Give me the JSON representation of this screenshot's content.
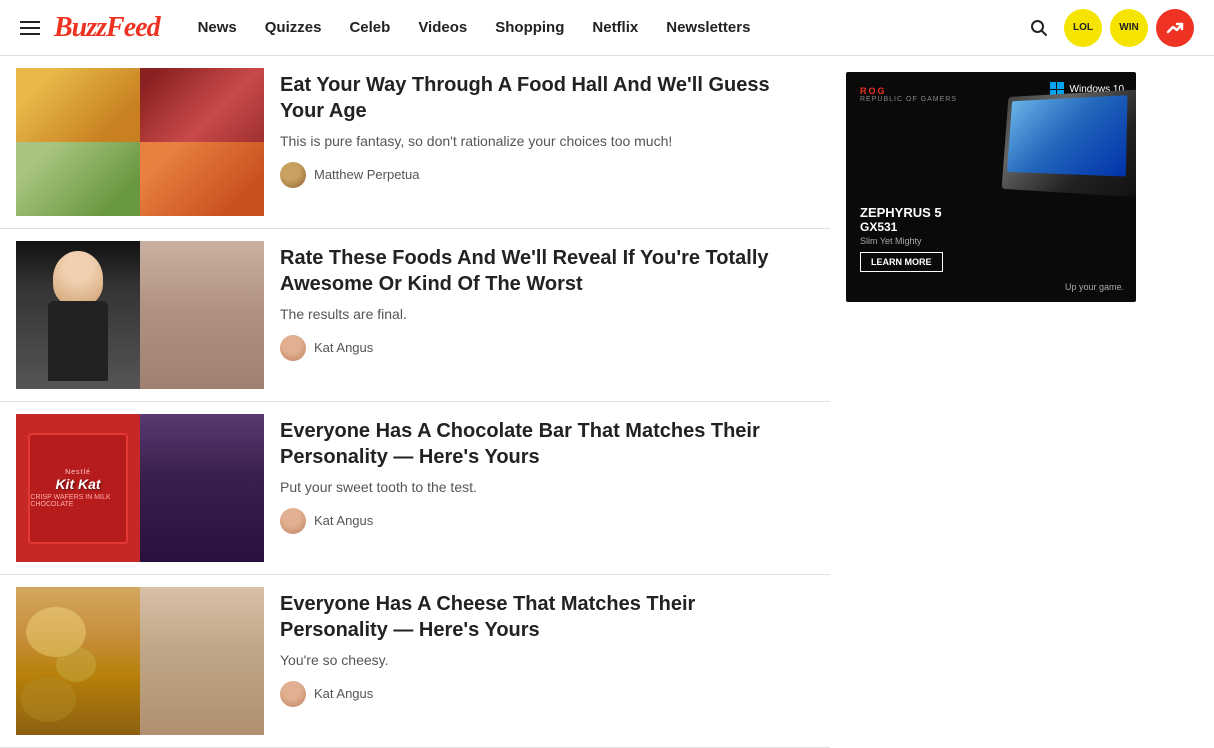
{
  "header": {
    "logo": "BuzzFeed",
    "hamburger_label": "menu",
    "search_label": "search",
    "badge_lol": "LOL",
    "badge_win": "WIN",
    "badge_trending": "↗"
  },
  "nav": {
    "items": [
      {
        "label": "News",
        "id": "news"
      },
      {
        "label": "Quizzes",
        "id": "quizzes"
      },
      {
        "label": "Celeb",
        "id": "celeb"
      },
      {
        "label": "Videos",
        "id": "videos"
      },
      {
        "label": "Shopping",
        "id": "shopping"
      },
      {
        "label": "Netflix",
        "id": "netflix"
      },
      {
        "label": "Newsletters",
        "id": "newsletters"
      }
    ]
  },
  "articles": [
    {
      "id": "food-hall",
      "title": "Eat Your Way Through A Food Hall And We'll Guess Your Age",
      "description": "This is pure fantasy, so don't rationalize your choices too much!",
      "author": "Matthew Perpetua",
      "author_id": "matthew"
    },
    {
      "id": "rate-foods",
      "title": "Rate These Foods And We'll Reveal If You're Totally Awesome Or Kind Of The Worst",
      "description": "The results are final.",
      "author": "Kat Angus",
      "author_id": "kat"
    },
    {
      "id": "chocolate-bar",
      "title": "Everyone Has A Chocolate Bar That Matches Their Personality — Here's Yours",
      "description": "Put your sweet tooth to the test.",
      "author": "Kat Angus",
      "author_id": "kat"
    },
    {
      "id": "cheese",
      "title": "Everyone Has A Cheese That Matches Their Personality — Here's Yours",
      "description": "You're so cheesy.",
      "author": "Kat Angus",
      "author_id": "kat"
    }
  ],
  "ad": {
    "brand": "ROG",
    "brand_full": "REPUBLIC OF GAMERS",
    "model": "ZEPHYRUS 5",
    "model_num": "GX531",
    "tagline": "Slim Yet Mighty",
    "cta": "LEARN MORE",
    "attribution": "Up your game.",
    "os": "Windows 10"
  }
}
